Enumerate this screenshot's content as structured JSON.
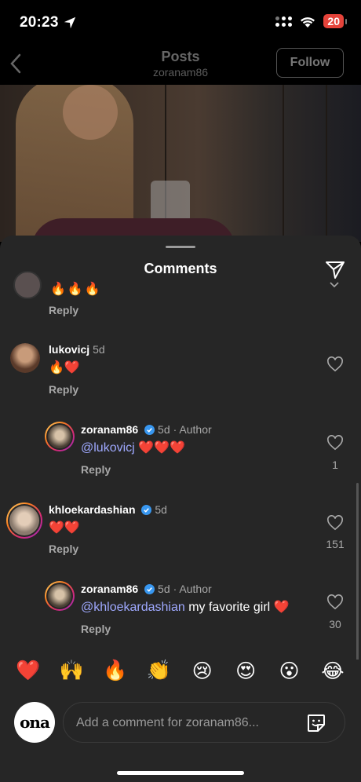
{
  "status_bar": {
    "time": "20:23",
    "battery": "20"
  },
  "nav": {
    "title": "Posts",
    "subtitle": "zoranam86",
    "follow_label": "Follow"
  },
  "sheet": {
    "title": "Comments"
  },
  "partial_comment": {
    "text": "🔥🔥🔥",
    "reply_label": "Reply"
  },
  "comments": [
    {
      "username": "lukovicj",
      "verified": false,
      "time": "5d",
      "author_tag": "",
      "mention": "",
      "text": "🔥❤️",
      "reply_label": "Reply",
      "likes": ""
    },
    {
      "username": "zoranam86",
      "verified": true,
      "time": "5d",
      "author_tag": "· Author",
      "mention": "@lukovicj",
      "text": " ❤️❤️❤️",
      "reply_label": "Reply",
      "likes": "1"
    },
    {
      "username": "khloekardashian",
      "verified": true,
      "time": "5d",
      "author_tag": "",
      "mention": "",
      "text": "❤️❤️",
      "reply_label": "Reply",
      "likes": "151"
    },
    {
      "username": "zoranam86",
      "verified": true,
      "time": "5d",
      "author_tag": "· Author",
      "mention": "@khloekardashian",
      "text": " my favorite girl ❤️",
      "reply_label": "Reply",
      "likes": "30"
    }
  ],
  "quick_emojis": [
    "❤️",
    "🙌",
    "🔥",
    "👏",
    "😢",
    "😍",
    "😮",
    "😂"
  ],
  "composer": {
    "avatar_text": "ona",
    "placeholder": "Add a comment for zoranam86..."
  },
  "colors": {
    "accent_mention": "#9fa9ff",
    "verified_blue": "#3897f0",
    "battery_red": "#e5433a"
  }
}
